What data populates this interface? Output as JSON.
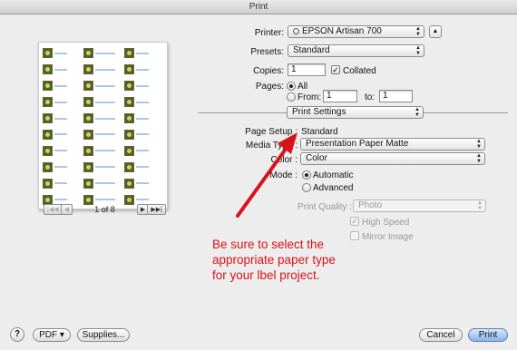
{
  "window": {
    "title": "Print"
  },
  "preview": {
    "pager": {
      "first": "|◀◀",
      "prev": "◀",
      "next": "▶",
      "last": "▶▶|",
      "count": "1 of 8"
    }
  },
  "printer": {
    "label": "Printer:",
    "value": "EPSON Artisan 700",
    "expand_label": "▲"
  },
  "presets": {
    "label": "Presets:",
    "value": "Standard"
  },
  "copies": {
    "label": "Copies:",
    "value": "1",
    "collated_label": "Collated",
    "collated_checked": true
  },
  "pages": {
    "label": "Pages:",
    "all_label": "All",
    "from_label": "From:",
    "from_value": "1",
    "to_label": "to:",
    "to_value": "1",
    "selected": "All"
  },
  "section": {
    "value": "Print Settings"
  },
  "page_setup": {
    "label": "Page Setup :",
    "value": "Standard"
  },
  "media_type": {
    "label": "Media Type :",
    "value": "Presentation Paper Matte"
  },
  "color": {
    "label": "Color :",
    "value": "Color"
  },
  "mode": {
    "label": "Mode :",
    "automatic_label": "Automatic",
    "advanced_label": "Advanced",
    "selected": "Automatic"
  },
  "print_quality": {
    "label": "Print Quality :",
    "value": "Photo"
  },
  "high_speed": {
    "label": "High Speed",
    "checked": true
  },
  "mirror_image": {
    "label": "Mirror Image",
    "checked": false
  },
  "footer": {
    "help": "?",
    "pdf": "PDF ▾",
    "supplies": "Supplies...",
    "cancel": "Cancel",
    "print": "Print"
  },
  "annotation": {
    "text": "Be sure to select the appropriate paper type for your lbel project.",
    "color": "#d8121a"
  }
}
